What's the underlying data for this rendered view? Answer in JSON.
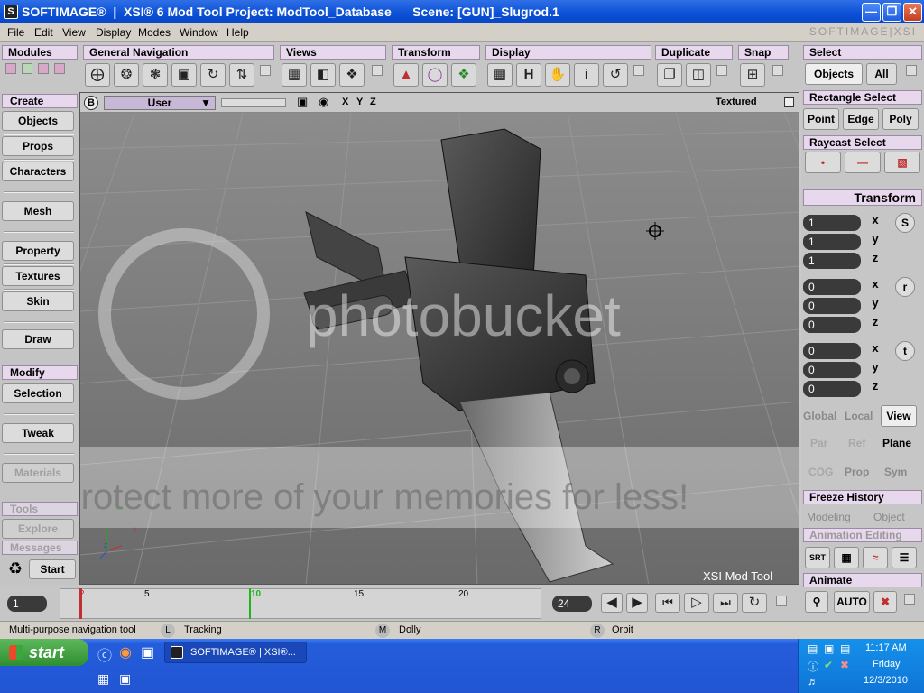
{
  "window": {
    "title": "SOFTIMAGE®  |  XSI® 6 Mod Tool Project: ModTool_Database      Scene: [GUN]_Slugrod.1",
    "app_icon": "softimage-icon",
    "brand": "SOFTIMAGE|XSI"
  },
  "menubar": {
    "items": [
      "File",
      "Edit",
      "View",
      "Display",
      "Modes",
      "Window",
      "Help"
    ]
  },
  "toolbar": {
    "groups": [
      {
        "label": "Modules"
      },
      {
        "label": "General Navigation"
      },
      {
        "label": "Views"
      },
      {
        "label": "Transform"
      },
      {
        "label": "Display"
      },
      {
        "label": "Duplicate"
      },
      {
        "label": "Snap"
      }
    ],
    "display_h": "H",
    "display_i": "i"
  },
  "left_panel": {
    "create_header": "Create",
    "create_buttons": [
      "Objects",
      "Props",
      "Characters",
      "Mesh",
      "Property",
      "Textures",
      "Skin",
      "Draw"
    ],
    "modify_header": "Modify",
    "modify_buttons": [
      "Selection",
      "Tweak",
      "Materials"
    ],
    "tools_header": "Tools",
    "explore": "Explore",
    "messages_header": "Messages",
    "start": "Start"
  },
  "viewport": {
    "b_label": "B",
    "camera": "User",
    "axes": [
      "X",
      "Y",
      "Z"
    ],
    "shading": "Textured",
    "brand": "XSI Mod Tool",
    "axis_gizmo": [
      "y",
      "x",
      "z"
    ],
    "watermark_brand": "photobucket",
    "watermark_text": "Protect more of your memories for less!"
  },
  "right_panel": {
    "select_header": "Select",
    "objects": "Objects",
    "all": "All",
    "rect_select_header": "Rectangle Select",
    "point": "Point",
    "edge": "Edge",
    "poly": "Poly",
    "raycast_header": "Raycast Select",
    "transform_header": "Transform",
    "scale": {
      "x": "1",
      "y": "1",
      "z": "1",
      "label": "S"
    },
    "rotate": {
      "x": "0",
      "y": "0",
      "z": "0",
      "label": "r"
    },
    "translate": {
      "x": "0",
      "y": "0",
      "z": "0",
      "label": "t"
    },
    "axis_labels": [
      "x",
      "y",
      "z"
    ],
    "global": "Global",
    "local": "Local",
    "view": "View",
    "par": "Par",
    "ref": "Ref",
    "plane": "Plane",
    "cog": "COG",
    "prop": "Prop",
    "sym": "Sym",
    "freeze_history": "Freeze History",
    "modeling": "Modeling",
    "object": "Object",
    "animation_editing": "Animation Editing",
    "srt": "SRT",
    "animate_header": "Animate",
    "auto": "AUTO"
  },
  "timeline": {
    "start_frame": "1",
    "end_frame": "24",
    "current_frame_marker": "2",
    "ticks": [
      "5",
      "10",
      "15",
      "20"
    ],
    "playhead": "10"
  },
  "status": {
    "left_hint": "Multi-purpose navigation tool",
    "l_key": "L",
    "l_action": "Tracking",
    "m_key": "M",
    "m_action": "Dolly",
    "r_key": "R",
    "r_action": "Orbit"
  },
  "taskbar": {
    "start": "start",
    "task_app": "SOFTIMAGE® | XSI®...",
    "time": "11:17 AM",
    "day": "Friday",
    "date": "12/3/2010"
  },
  "colors": {
    "title_blue": "#0a4fd6",
    "header_lavender": "#e8d8ee",
    "viewport_grey": "#7c7c7c",
    "taskbar_blue": "#245ddb",
    "start_green": "#2f8f2f"
  }
}
